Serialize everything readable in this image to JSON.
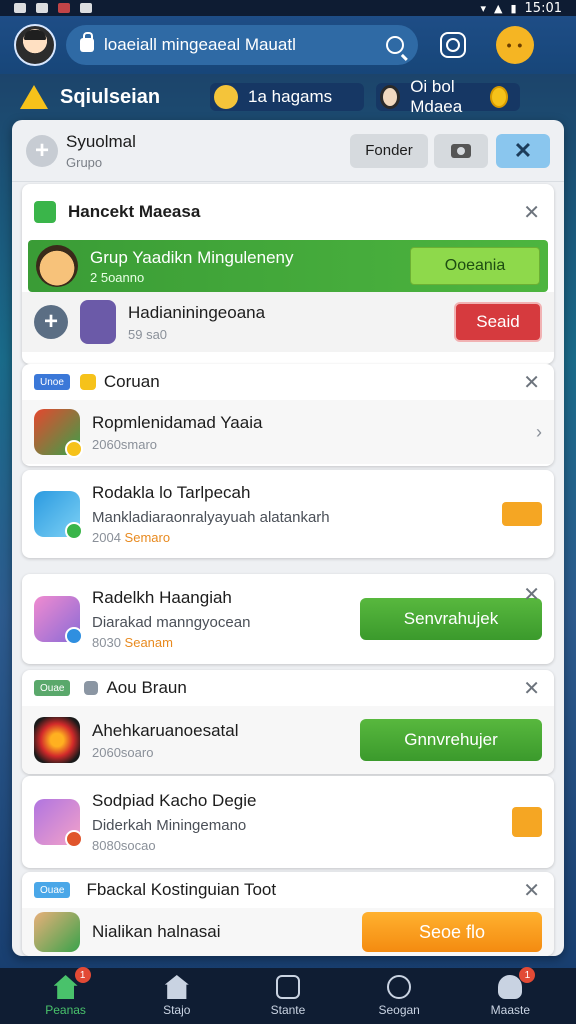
{
  "status_bar": {
    "time": "15:01"
  },
  "topbar": {
    "search_text": "loaeiall mingeaeal Mauatl"
  },
  "subheader": {
    "title": "Sqiulseian",
    "pill1": "1a hagams",
    "pill2": "Oi bol Mdaea"
  },
  "panel": {
    "title": "Syuolmal",
    "subtitle": "Grupo",
    "follow_label": "Fonder"
  },
  "section1": {
    "title": "Hancekt Maeasa",
    "banner_title": "Grup Yaadikn Minguleneny",
    "banner_sub": "2 5oanno",
    "banner_button": "Ooeania",
    "request_title": "Hadianiningeoana",
    "request_meta": "59 sa0",
    "request_button": "Seaid"
  },
  "section2": {
    "tag": "Unoe",
    "title": "Coruan",
    "item1_title": "Ropmlenidamad Yaaia",
    "item1_meta": "2060smaro"
  },
  "item2": {
    "title": "Rodakla lo Tarlpecah",
    "desc": "Mankladiaraonralyayuah alatankarh",
    "meta_prefix": "2004 ",
    "meta_hl": "Semaro"
  },
  "item3": {
    "title": "Radelkh Haangiah",
    "desc": "Diarakad manngyocean",
    "meta_prefix": "8030 ",
    "meta_hl": "Seanam",
    "button": "Senvrahujek"
  },
  "section3": {
    "tag": "Ouae",
    "title": "Aou Braun",
    "item_title": "Ahehkaruanoesatal",
    "item_meta": "2060soaro",
    "button": "Gnnvrehujer"
  },
  "item4": {
    "title": "Sodpiad Kacho Degie",
    "desc": "Diderkah Miningemano",
    "meta": "8080socao"
  },
  "section4": {
    "tag": "Ouae",
    "title": "Fbackal Kostinguian Toot",
    "item_title": "Nialikan halnasai",
    "button": "Seoe flo"
  },
  "bottom_nav": {
    "items": [
      {
        "label": "Peanas",
        "badge": "1",
        "active": true
      },
      {
        "label": "Stajo",
        "active": false
      },
      {
        "label": "Stante",
        "active": false
      },
      {
        "label": "Seogan",
        "active": false
      },
      {
        "label": "Maaste",
        "badge": "1",
        "active": false
      }
    ]
  }
}
